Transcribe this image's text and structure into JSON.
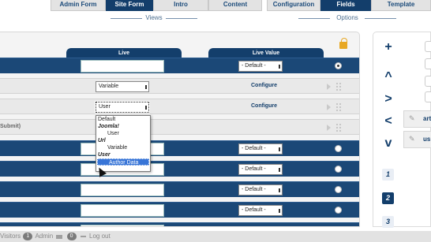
{
  "top_tabs": {
    "views": [
      {
        "label": "Admin Form"
      },
      {
        "label": "Site Form"
      },
      {
        "label": "Intro"
      },
      {
        "label": "Content"
      }
    ],
    "options": [
      {
        "label": "Configuration"
      },
      {
        "label": "Fields"
      },
      {
        "label": "Template"
      }
    ],
    "views_label": "Views",
    "options_label": "Options"
  },
  "columns": {
    "live": "Live",
    "live_value": "Live Value"
  },
  "rows": {
    "variable_select": "Variable",
    "user_select": "User",
    "configure": "Configure",
    "submit_label": "Submit)",
    "default_value": "- Default -"
  },
  "dropdown": {
    "options": [
      "Default",
      "Joomla!",
      "User",
      "Url",
      "Variable",
      "User",
      "Author Data"
    ]
  },
  "sidebar": {
    "fields": [
      "art",
      "us"
    ],
    "pages": [
      "1",
      "2",
      "3"
    ]
  },
  "footer": {
    "visitors_label": "Visitors",
    "visitors_count": "1",
    "admin_label": "Admin",
    "messages_count": "0",
    "logout_label": "Log out"
  },
  "colors": {
    "primary": "#133e6b",
    "lock": "#e8a825",
    "selected": "#3875d7"
  }
}
